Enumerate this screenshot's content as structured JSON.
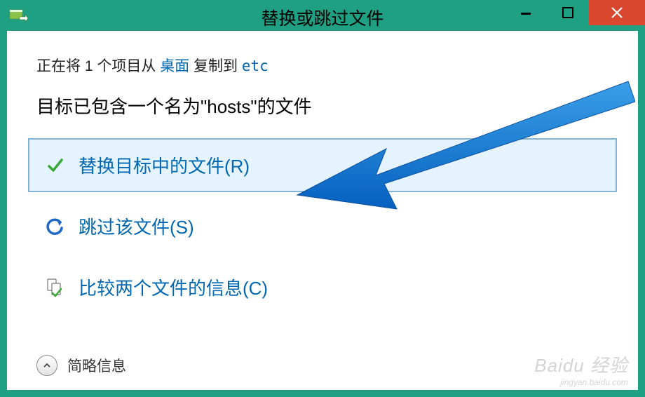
{
  "titlebar": {
    "title": "替换或跳过文件"
  },
  "copy_line": {
    "prefix": "正在将 1 个项目从 ",
    "source": "桌面",
    "middle": " 复制到 ",
    "dest": "etc"
  },
  "conflict": "目标已包含一个名为\"hosts\"的文件",
  "options": {
    "replace": "替换目标中的文件(R)",
    "skip": "跳过该文件(S)",
    "compare": "比较两个文件的信息(C)"
  },
  "footer": {
    "details": "简略信息"
  },
  "watermark": {
    "main": "Baidu 经验",
    "sub": "jingyan.baidu.com"
  }
}
